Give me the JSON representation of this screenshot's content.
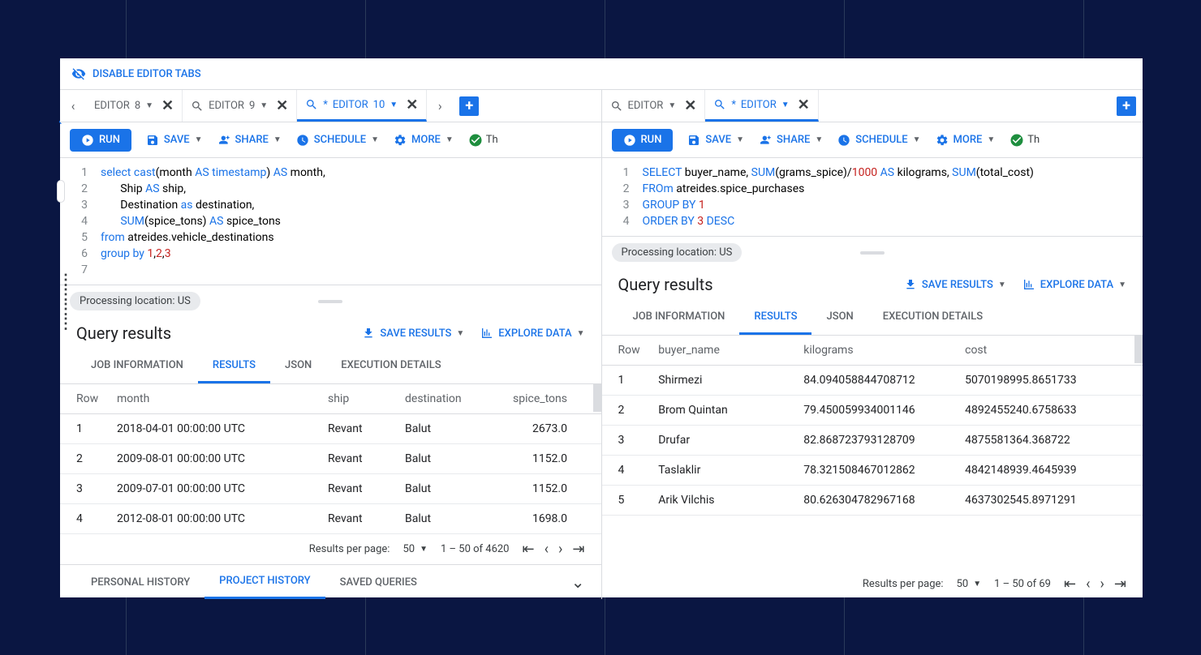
{
  "top": {
    "disable_editor_tabs": "DISABLE EDITOR TABS"
  },
  "left_pane": {
    "tabs": [
      {
        "label": "EDITOR",
        "num": "8"
      },
      {
        "label": "EDITOR",
        "num": "9"
      },
      {
        "star": "*",
        "label": "EDITOR",
        "num": "10",
        "active": true
      }
    ],
    "toolbar": {
      "run": "RUN",
      "save": "SAVE",
      "share": "SHARE",
      "schedule": "SCHEDULE",
      "more": "MORE",
      "status": "Th"
    },
    "code_lines": [
      "1",
      "2",
      "3",
      "4",
      "5",
      "6",
      "7"
    ],
    "processing": "Processing location: US",
    "results_title": "Query results",
    "save_results": "SAVE RESULTS",
    "explore_data": "EXPLORE DATA",
    "result_tabs": {
      "job": "JOB INFORMATION",
      "results": "RESULTS",
      "json": "JSON",
      "exec": "EXECUTION DETAILS"
    },
    "columns": {
      "row": "Row",
      "month": "month",
      "ship": "ship",
      "dest": "destination",
      "tons": "spice_tons"
    },
    "rows": [
      {
        "n": "1",
        "month": "2018-04-01 00:00:00 UTC",
        "ship": "Revant",
        "dest": "Balut",
        "tons": "2673.0"
      },
      {
        "n": "2",
        "month": "2009-08-01 00:00:00 UTC",
        "ship": "Revant",
        "dest": "Balut",
        "tons": "1152.0"
      },
      {
        "n": "3",
        "month": "2009-07-01 00:00:00 UTC",
        "ship": "Revant",
        "dest": "Balut",
        "tons": "1152.0"
      },
      {
        "n": "4",
        "month": "2012-08-01 00:00:00 UTC",
        "ship": "Revant",
        "dest": "Balut",
        "tons": "1698.0"
      }
    ],
    "pagination": {
      "label": "Results per page:",
      "per": "50",
      "range": "1 – 50 of 4620"
    },
    "bottom_tabs": {
      "personal": "PERSONAL HISTORY",
      "project": "PROJECT HISTORY",
      "saved": "SAVED QUERIES"
    }
  },
  "right_pane": {
    "tabs": [
      {
        "label": "EDITOR"
      },
      {
        "star": "*",
        "label": "EDITOR",
        "active": true
      }
    ],
    "toolbar": {
      "run": "RUN",
      "save": "SAVE",
      "share": "SHARE",
      "schedule": "SCHEDULE",
      "more": "MORE",
      "status": "Th"
    },
    "code_lines": [
      "1",
      "2",
      "3",
      "4"
    ],
    "processing": "Processing location: US",
    "results_title": "Query results",
    "save_results": "SAVE RESULTS",
    "explore_data": "EXPLORE DATA",
    "result_tabs": {
      "job": "JOB INFORMATION",
      "results": "RESULTS",
      "json": "JSON",
      "exec": "EXECUTION DETAILS"
    },
    "columns": {
      "row": "Row",
      "buyer": "buyer_name",
      "kg": "kilograms",
      "cost": "cost"
    },
    "rows": [
      {
        "n": "1",
        "buyer": "Shirmezi",
        "kg": "84.094058844708712",
        "cost": "5070198995.8651733"
      },
      {
        "n": "2",
        "buyer": "Brom Quintan",
        "kg": "79.450059934001146",
        "cost": "4892455240.6758633"
      },
      {
        "n": "3",
        "buyer": "Drufar",
        "kg": "82.868723793128709",
        "cost": "4875581364.368722"
      },
      {
        "n": "4",
        "buyer": "Taslaklir",
        "kg": "78.321508467012862",
        "cost": "4842148939.4645939"
      },
      {
        "n": "5",
        "buyer": "Arik Vilchis",
        "kg": "80.626304782967168",
        "cost": "4637302545.8971291"
      }
    ],
    "pagination": {
      "label": "Results per page:",
      "per": "50",
      "range": "1 – 50 of 69"
    }
  }
}
